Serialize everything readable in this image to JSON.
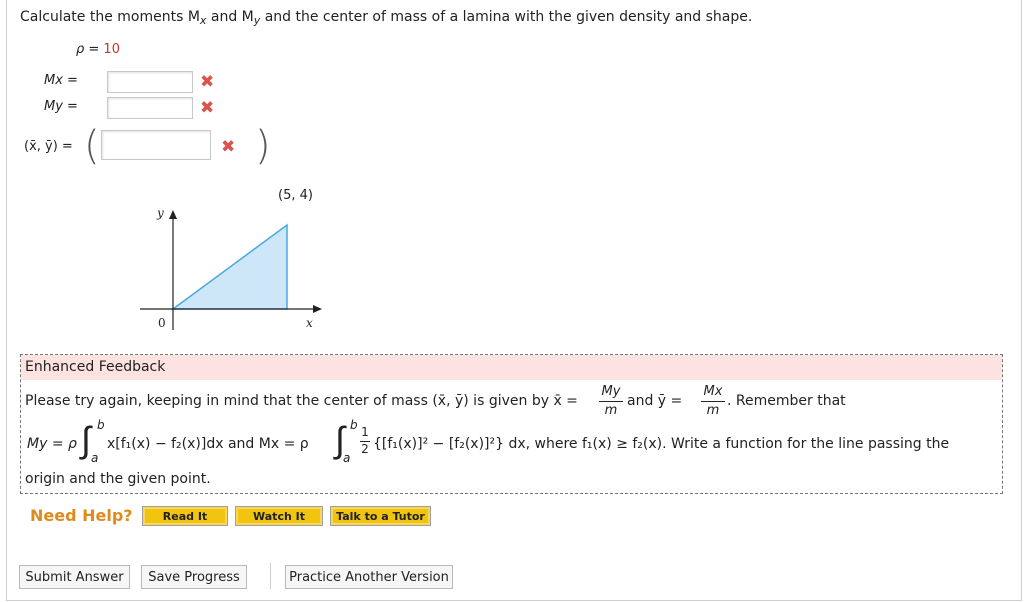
{
  "question": {
    "text": "Calculate the moments M",
    "x_sub": "x",
    "and": " and M",
    "y_sub": "y",
    "rest": " and the center of mass of a lamina with the given density and shape."
  },
  "density": {
    "label": "ρ = ",
    "value": "10"
  },
  "fields": {
    "mx_label": "Mx =",
    "my_label": "My =",
    "center_label": "(x̄, ȳ) =",
    "mx_value": "",
    "my_value": "",
    "center_value": ""
  },
  "graph": {
    "point_label": "(5, 4)",
    "x_axis": "x",
    "y_axis": "y",
    "origin": "0",
    "fill_color": "#cde7f8",
    "stroke_color": "#4aa8e0"
  },
  "feedback": {
    "title": "Enhanced Feedback",
    "line1_a": "Please try again, keeping in mind that the center of mass  (x̄, ȳ)  is given by  x̄ = ",
    "line1_b": "  and  ȳ = ",
    "line1_c": ".  Remember that",
    "my_num": "My",
    "mx_num": "Mx",
    "den": "m",
    "line2_a": "My = ρ",
    "line2_b": "x[f₁(x) − f₂(x)]dx  and  Mx = ρ",
    "line2_c": "{[f₁(x)]² − [f₂(x)]²} dx,  where  f₁(x) ≥ f₂(x).  Write a function for the line passing the",
    "half_num": "1",
    "half_den": "2",
    "lim_b": "b",
    "lim_a": "a",
    "line3": "origin and the given point."
  },
  "help": {
    "need_help": "Need Help?",
    "read_it": "Read It",
    "watch_it": "Watch It",
    "talk_tutor": "Talk to a Tutor"
  },
  "actions": {
    "submit": "Submit Answer",
    "save": "Save Progress",
    "practice": "Practice Another Version"
  },
  "colors": {
    "error": "#d9534f",
    "help_orange": "#e08a1e",
    "feedback_bg": "#fde2e2",
    "help_btn": "#f1c40f"
  }
}
